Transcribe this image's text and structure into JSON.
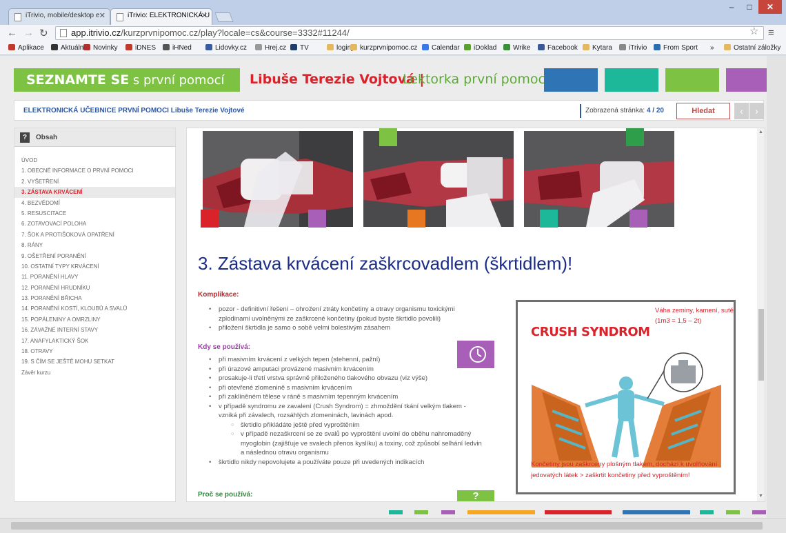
{
  "browser": {
    "tabs": [
      {
        "label": "iTrivio, mobile/desktop e"
      },
      {
        "label": "iTrivio: ELEKTRONICKÁ U"
      }
    ],
    "url_domain": "app.itrivio.cz",
    "url_path": "/kurzprvnipomoc.cz/play?locale=cs&course=3332#11244/",
    "bookmarks": [
      {
        "label": "Aplikace",
        "color": "#c0392b"
      },
      {
        "label": "Aktuálně",
        "color": "#333333"
      },
      {
        "label": "Novinky",
        "color": "#b03030"
      },
      {
        "label": "iDNES",
        "color": "#c0392b"
      },
      {
        "label": "iHNed",
        "color": "#555555"
      },
      {
        "label": "Lidovky.cz",
        "color": "#3a5ba0"
      },
      {
        "label": "Hrej.cz",
        "color": "#999999"
      },
      {
        "label": "TV",
        "color": "#1e3d6b"
      },
      {
        "label": "loginy",
        "color": "#e3b860"
      },
      {
        "label": "kurzprvnipomoc.cz",
        "color": "#e3b860"
      },
      {
        "label": "Calendar",
        "color": "#3b78e7"
      },
      {
        "label": "iDoklad",
        "color": "#5aa02c"
      },
      {
        "label": "Wrike",
        "color": "#3a8f3a"
      },
      {
        "label": "Facebook",
        "color": "#3b5998"
      },
      {
        "label": "Kytara",
        "color": "#e3b860"
      },
      {
        "label": "iTrivio",
        "color": "#888888"
      },
      {
        "label": "From Sport",
        "color": "#2b6cb0"
      }
    ],
    "bookmarks_more": "»",
    "bookmarks_other": "Ostatní záložky"
  },
  "banner": {
    "intro_bold": "SEZNAMTE SE",
    "intro_rest": " s první pomocí",
    "name": "Libuše Terezie Vojtová |",
    "role": "Lektorka první pomoci",
    "blocks": [
      "#2f74b5",
      "#1db89a",
      "#7dc242",
      "#a85fb8"
    ]
  },
  "infobar": {
    "book_title": "ELEKTRONICKÁ UČEBNICE PRVNÍ POMOCI Libuše Terezie Vojtové",
    "page_label": "Zobrazená stránka:",
    "page_current": "4",
    "page_sep": "/",
    "page_total": "20",
    "search_label": "Hledat",
    "prev": "‹",
    "next": "›"
  },
  "sidebar": {
    "title": "Obsah",
    "items": [
      {
        "label": "ÚVOD"
      },
      {
        "label": "1. OBECNÉ INFORMACE O PRVNÍ POMOCI"
      },
      {
        "label": "2. VYŠETŘENÍ"
      },
      {
        "label": "3. ZÁSTAVA KRVÁCENÍ",
        "active": true
      },
      {
        "label": "4. BEZVĚDOMÍ"
      },
      {
        "label": "5. RESUSCITACE"
      },
      {
        "label": "6. ZOTAVOVACÍ POLOHA"
      },
      {
        "label": "7. ŠOK A PROTIŠOKOVÁ OPATŘENÍ"
      },
      {
        "label": "8. RÁNY"
      },
      {
        "label": "9. OŠETŘENÍ PORANĚNÍ"
      },
      {
        "label": "10. OSTATNÍ TYPY KRVÁCENÍ"
      },
      {
        "label": "11. PORANĚNÍ HLAVY"
      },
      {
        "label": "12. PORANĚNÍ HRUDNÍKU"
      },
      {
        "label": "13. PORANĚNÍ BŘICHA"
      },
      {
        "label": "14. PORANĚNÍ KOSTÍ, KLOUBŮ A SVALŮ"
      },
      {
        "label": "15. POPÁLENINY A OMRZLINY"
      },
      {
        "label": "16. ZÁVAŽNÉ INTERNÍ STAVY"
      },
      {
        "label": "17. ANAFYLAKTICKÝ ŠOK"
      },
      {
        "label": "18. OTRAVY"
      },
      {
        "label": "19. S ČÍM SE JEŠTĚ MOHU SETKAT"
      },
      {
        "label": "Závěr kurzu"
      }
    ]
  },
  "content": {
    "photo_squares": [
      "#d9222a",
      "#a85fb8",
      "#7dc242",
      "#e87722",
      "#2e9e4a",
      "#1db89a",
      "#a85fb8"
    ],
    "heading": "3. Zástava krvácení zaškrcovadlem (škrtidlem)!",
    "komplikace": {
      "title": "Komplikace:",
      "items": [
        "pozor - definitivní řešení – ohrožení ztráty končetiny a otravy organismu toxickými",
        "zplodinami uvolněnými ze zaškrcené končetiny (pokud byste škrtidlo povolili)",
        "přiložení škrtidla je samo o sobě velmi bolestivým zásahem"
      ]
    },
    "kdy": {
      "title": "Kdy se používá:",
      "items": [
        "při masivním krvácení z velkých tepen (stehenní, pažní)",
        "při úrazové amputaci provázené masivním krvácením",
        "prosakuje-li třetí vrstva správně přiloženého tlakového obvazu (viz výše)",
        "při otevřené zlomenině s masivním krvácením",
        "při zaklíněném tělese v ráně s masivním tepenným krvácením",
        "v případě syndromu ze zavalení (Crush Syndrom) = zhmoždění tkání velkým tlakem -",
        "vzniká při závalech, rozsáhlých zlomeninách, lavinách apod."
      ],
      "subitems": [
        "škrtidlo přikládáte ještě před vyproštěním",
        "v případě nezaškrcení se ze svalů po vyproštění uvolní do oběhu nahromaděný",
        "myoglobin (zajišťuje ve svalech přenos kyslíku) a toxiny, což způsobí selhání ledvin",
        "a následnou otravu organismu"
      ],
      "last_item": "škrtidlo nikdy nepovolujete a používáte pouze při uvedených indikacích"
    },
    "proc": {
      "title": "Proč se používá:",
      "badge": "?"
    },
    "crush": {
      "title": "CRUSH SYNDROM",
      "weight_line1": "Váha zeminy, kamení, sutě",
      "weight_line2": "(1m3 = 1,5 – 2t)",
      "caption_line1": "Končetiny jsou zaškrceny plošným tlakem, dochází k uvolňování",
      "caption_line2": "jedovatých látek > zaškrtit končetiny před vyproštěním!"
    }
  },
  "footer_stripes": [
    "#1db89a",
    "#7dc242",
    "#a85fb8",
    "#f7a823",
    "#d9222a",
    "#2f74b5",
    "#1db89a",
    "#7dc242",
    "#a85fb8"
  ]
}
